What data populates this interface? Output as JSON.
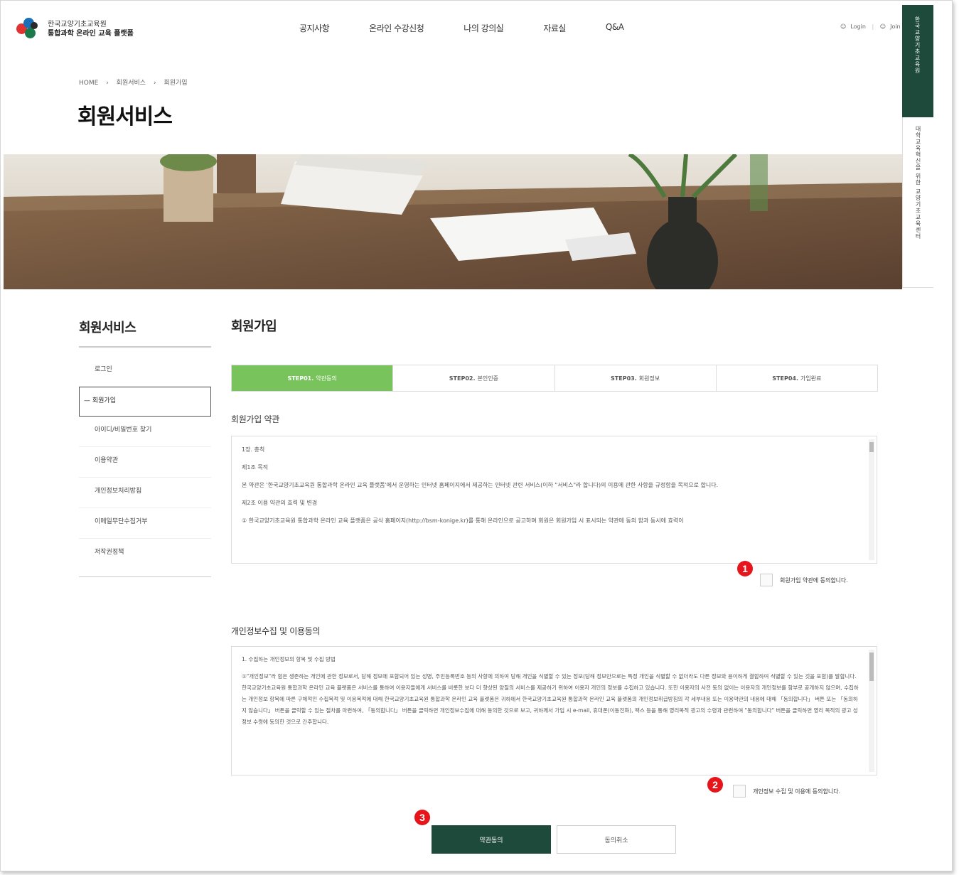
{
  "header": {
    "logo_line1": "한국교양기초교육원",
    "logo_line2": "통합과학 온라인 교육 플랫폼",
    "nav": [
      "공지사항",
      "온라인 수강신청",
      "나의 강의실",
      "자료실",
      "Q&A"
    ],
    "login": "Login",
    "join": "Join"
  },
  "side_tabs": {
    "dark": "한국교양기초교육원",
    "light": "대학교육혁신을 위한 교양기초교육센터"
  },
  "breadcrumb": [
    "HOME",
    "회원서비스",
    "회원가입"
  ],
  "page_title": "회원서비스",
  "lnb": {
    "title": "회원서비스",
    "items": [
      "로그인",
      "회원가입",
      "아이디/비밀번호 찾기",
      "이용약관",
      "개인정보처리방침",
      "이메일무단수집거부",
      "저작권정책"
    ],
    "active_index": 1
  },
  "content": {
    "title": "회원가입",
    "steps": [
      {
        "num": "STEP01.",
        "label": "약관동의"
      },
      {
        "num": "STEP02.",
        "label": "본인인증"
      },
      {
        "num": "STEP03.",
        "label": "회원정보"
      },
      {
        "num": "STEP04.",
        "label": "가입완료"
      }
    ],
    "terms_title": "회원가입 약관",
    "terms_text": [
      "1장. 총칙",
      "제1조 목적",
      "본 약관은 '한국교양기초교육원 통합과학 온라인 교육 플랫폼'에서 운영하는 인터넷 홈페이지에서 제공하는 인터넷 관련 서비스(이하 \"서비스\"라 합니다)의 이용에 관한 사항을 규정함을 목적으로 합니다.",
      "제2조 이용 약관의 효력 및 변경",
      "① 한국교양기초교육원 통합과학 온라인 교육 플랫폼은 공식 홈페이지(http://bsm-konige.kr)를 통해 온라인으로 공고하며 회원은 회원가입 시 표시되는 약관에 동의 함과 동시에 효력이"
    ],
    "terms_agree": "회원가입 약관에 동의합니다.",
    "privacy_title": "개인정보수집 및 이용동의",
    "privacy_text": [
      "1. 수집하는 개인정보의 항목 및 수집 방법",
      "①\"개인정보\"라 함은 생존하는 개인에 관한 정보로서, 당해 정보에 포함되어 있는 성명, 주민등록번호 등의 사항에 의하여 당해 개인을 식별할 수 있는 정보(당해 정보만으로는 특정 개인을 식별할 수 없더라도 다른 정보와 용이하게 결합하여 식별할 수 있는 것을 포함)를 말합니다. 한국교양기초교육원 통합과학 온라인 교육 플랫폼은 서비스를 통하여 이용자들에게 서비스를 비롯한 보다 더 향상된 양질의 서비스를 제공하기 위하여 이용자 개인의 정보를 수집하고 있습니다. 또한 이용자의 사전 동의 없이는 이용자의 개인정보를 함부로 공개하지 않으며, 수집하는 개인정보 항목에 따른 구체적인 수집목적 및 이용목적에 대해 한국교양기초교육원 통합과학 온라인 교육 플랫폼은 귀하에서 한국교양기초교육원 통합과학 온라인 교육 플랫폼의 개인정보취급방침의 각 세부내용 또는 이용약관의 내용에 대해 「동의합니다」 버튼 또는 「동의하지 않습니다」 버튼을 클릭할 수 있는 절차를 마련하여, 「동의합니다」 버튼을 클릭하면 개인정보수집에 대해 동의한 것으로 보고, 귀하께서 가입 시 e-mail, 휴대폰(이동전화), 팩스 등을 통해 영리목적 광고의 수령과 관련하여 \"동의합니다\" 버튼을 클릭하면 영리 목적의 광고 성 정보 수령에 동의한 것으로 간주합니다."
    ],
    "privacy_agree": "개인정보 수집 및 이용에 동의합니다.",
    "btn_agree": "약관동의",
    "btn_cancel": "동의취소"
  },
  "badges": [
    "1",
    "2",
    "3"
  ],
  "colors": {
    "brand_dark": "#1d4a3b",
    "step_active": "#79c35c",
    "badge": "#e8141b"
  }
}
